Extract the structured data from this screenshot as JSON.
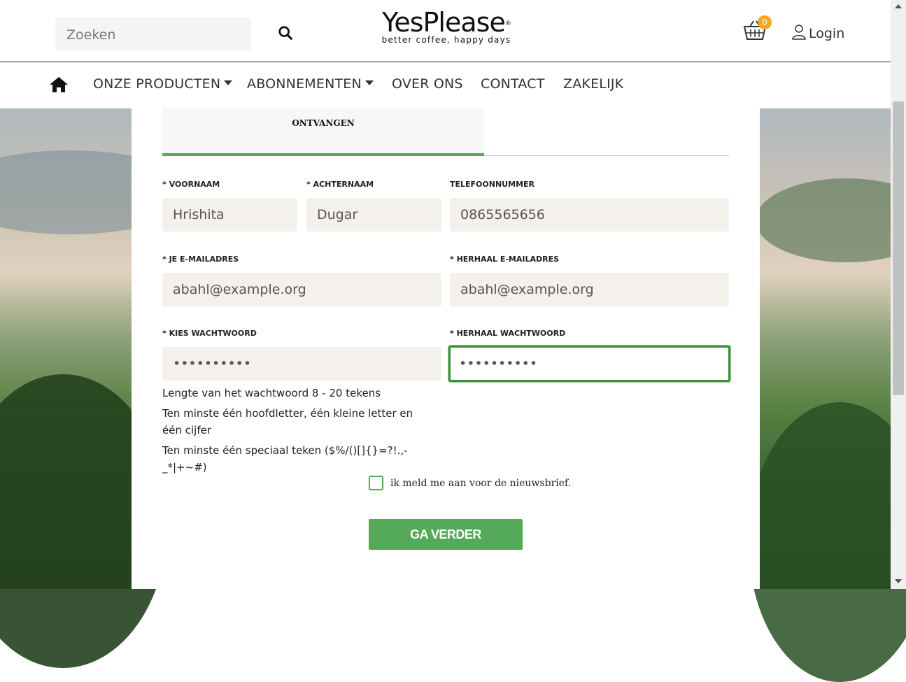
{
  "search": {
    "placeholder": "Zoeken",
    "icon": "search-icon"
  },
  "logo": {
    "name": "YesPlease",
    "registered": "®",
    "tagline": "better coffee, happy days"
  },
  "header": {
    "cart_count": "0",
    "login_label": "Login"
  },
  "nav": {
    "items": [
      {
        "label": "ONZE PRODUCTEN",
        "dropdown": true
      },
      {
        "label": "ABONNEMENTEN",
        "dropdown": true
      },
      {
        "label": "OVER ONS",
        "dropdown": false
      },
      {
        "label": "CONTACT",
        "dropdown": false
      },
      {
        "label": "ZAKELIJK",
        "dropdown": false
      }
    ]
  },
  "tabs": {
    "active_label": "ONTVANGEN"
  },
  "form": {
    "first_name": {
      "label": "* VOORNAAM",
      "value": "Hrishita"
    },
    "last_name": {
      "label": "* ACHTERNAAM",
      "value": "Dugar"
    },
    "phone": {
      "label": "TELEFOONNUMMER",
      "value": "0865565656"
    },
    "email": {
      "label": "* JE E-MAILADRES",
      "value": "abahl@example.org"
    },
    "email_repeat": {
      "label": "* HERHAAL E-MAILADRES",
      "value": "abahl@example.org"
    },
    "password": {
      "label": "* KIES WACHTWOORD",
      "value": "••••••••••"
    },
    "password_repeat": {
      "label": "* HERHAAL WACHTWOORD",
      "value": "••••••••••"
    },
    "hints": [
      "Lengte van het wachtwoord 8 - 20 tekens",
      "Ten minste één hoofdletter, één kleine letter en één cijfer",
      "Ten minste één speciaal teken ($%/()[]{}=?!.,-_*|+~#)"
    ],
    "newsletter_label": "ik meld me aan voor de nieuwsbrief.",
    "submit_label": "GA VERDER"
  },
  "colors": {
    "accent": "#55a95a",
    "badge": "#f5a623",
    "field_bg": "#f4f1ec"
  }
}
